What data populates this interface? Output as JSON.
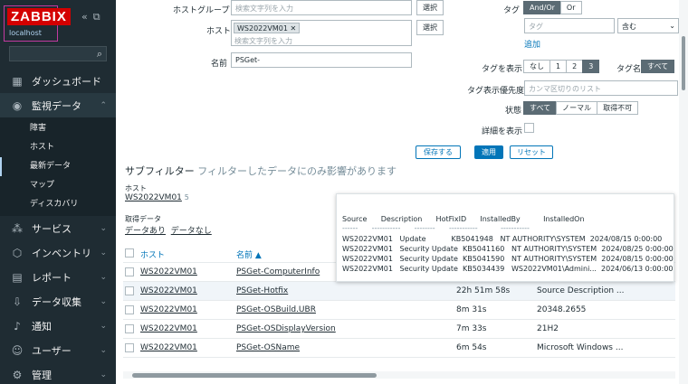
{
  "brand": {
    "logo": "ZABBIX",
    "host": "localhost"
  },
  "sidebar": {
    "items": [
      {
        "icon": "dashboard-icon",
        "label": "ダッシュボード"
      },
      {
        "icon": "monitoring-icon",
        "label": "監視データ"
      },
      {
        "icon": "services-icon",
        "label": "サービス"
      },
      {
        "icon": "inventory-icon",
        "label": "インベントリ"
      },
      {
        "icon": "reports-icon",
        "label": "レポート"
      },
      {
        "icon": "data-collection-icon",
        "label": "データ収集"
      },
      {
        "icon": "alerts-icon",
        "label": "通知"
      },
      {
        "icon": "users-icon",
        "label": "ユーザー"
      },
      {
        "icon": "admin-icon",
        "label": "管理"
      }
    ],
    "sub_items": [
      "障害",
      "ホスト",
      "最新データ",
      "マップ",
      "ディスカバリ"
    ]
  },
  "filter": {
    "hostgroup_label": "ホストグループ",
    "hostgroup_placeholder": "検索文字列を入力",
    "select_label": "選択",
    "host_label": "ホスト",
    "host_chip": "WS2022VM01",
    "host_placeholder": "検索文字列を入力",
    "name_label": "名前",
    "name_value": "PSGet-",
    "tag_label": "タグ",
    "tag_andor": "And/Or",
    "tag_or": "Or",
    "tag_placeholder": "タグ",
    "tag_op": "含む",
    "add_link": "追加",
    "show_tags_label": "タグを表示",
    "show_tags_options": [
      "なし",
      "1",
      "2",
      "3"
    ],
    "tag_name_label": "タグ名",
    "tag_name_all": "すべて",
    "tag_priority_label": "タグ表示優先度",
    "tag_priority_placeholder": "カンマ区切りのリスト",
    "state_label": "状態",
    "state_options": [
      "すべて",
      "ノーマル",
      "取得不可"
    ],
    "details_label": "詳細を表示",
    "save_button": "保存する",
    "apply_button": "適用",
    "reset_button": "リセット"
  },
  "subfilter": {
    "title": "サブフィルター",
    "note": "フィルターしたデータにのみ影響があります",
    "host_label": "ホスト",
    "host_value": "WS2022VM01",
    "host_count": "5",
    "data_label": "取得データ",
    "data_with": "データあり",
    "data_without": "データなし"
  },
  "table": {
    "headers": {
      "host": "ホスト",
      "name": "名前"
    },
    "rows": [
      {
        "host": "WS2022VM01",
        "name": "PSGet-ComputerInfo",
        "last_check": "",
        "value": ""
      },
      {
        "host": "WS2022VM01",
        "name": "PSGet-Hotfix",
        "last_check": "22h 51m 58s",
        "value": "Source Description ..."
      },
      {
        "host": "WS2022VM01",
        "name": "PSGet-OSBuild.UBR",
        "last_check": "8m 31s",
        "value": "20348.2655"
      },
      {
        "host": "WS2022VM01",
        "name": "PSGet-OSDisplayVersion",
        "last_check": "7m 33s",
        "value": "21H2"
      },
      {
        "host": "WS2022VM01",
        "name": "PSGet-OSName",
        "last_check": "6m 54s",
        "value": "Microsoft Windows ..."
      }
    ]
  },
  "tooltip": {
    "header": "Source      Description      HotFixID      InstalledBy          InstalledOn",
    "underline": "------      -----------      --------      -----------          -----------",
    "rows": [
      "WS2022VM01   Update           KB5041948   NT AUTHORITY\\SYSTEM  2024/08/15 0:00:00",
      "WS2022VM01   Security Update  KB5041160   NT AUTHORITY\\SYSTEM  2024/08/25 0:00:00",
      "WS2022VM01   Security Update  KB5041590   NT AUTHORITY\\SYSTEM  2024/08/15 0:00:00",
      "WS2022VM01   Security Update  KB5034439   WS2022VM01\\Admini...  2024/06/13 0:00:00"
    ]
  }
}
